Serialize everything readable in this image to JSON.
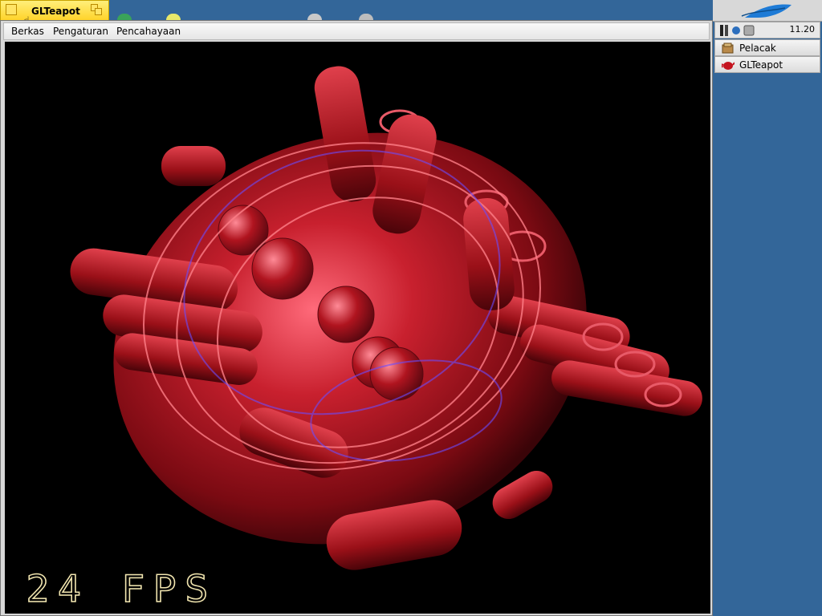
{
  "window": {
    "title": "GLTeapot",
    "menus": [
      "Berkas",
      "Pengaturan",
      "Pencahayaan"
    ],
    "fps_text": "24 FPS"
  },
  "deskbar": {
    "clock": "11.20",
    "apps": [
      {
        "label": "Pelacak",
        "icon": "tracker-icon"
      },
      {
        "label": "GLTeapot",
        "icon": "teapot-icon"
      }
    ]
  },
  "colors": {
    "desktop": "#336699",
    "tab": "#ffd32a",
    "teapot": "#b3141f"
  }
}
